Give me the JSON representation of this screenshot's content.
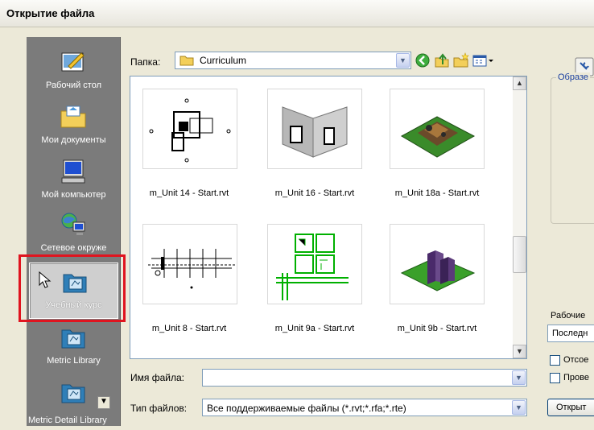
{
  "window": {
    "title": "Открытие файла"
  },
  "places": [
    {
      "label": "Рабочий стол",
      "icon": "desktop-icon"
    },
    {
      "label": "Мои документы",
      "icon": "my-documents-icon"
    },
    {
      "label": "Мой компьютер",
      "icon": "my-computer-icon"
    },
    {
      "label": "Сетевое окруже",
      "icon": "network-icon"
    },
    {
      "label": "Учебный курс",
      "icon": "training-folder-icon",
      "selected": true
    },
    {
      "label": "Metric Library",
      "icon": "library-folder-icon"
    },
    {
      "label": "Metric Detail Library",
      "icon": "library-folder-icon"
    }
  ],
  "toolbar": {
    "folder_label": "Папка:",
    "folder_value": "Curriculum"
  },
  "files": [
    {
      "name": "m_Unit 14 - Start.rvt"
    },
    {
      "name": "m_Unit 16 - Start.rvt"
    },
    {
      "name": "m_Unit 18a - Start.rvt"
    },
    {
      "name": "m_Unit 8 - Start.rvt"
    },
    {
      "name": "m_Unit 9a - Start.rvt"
    },
    {
      "name": "m_Unit 9b - Start.rvt"
    }
  ],
  "filename": {
    "label": "Имя файла:",
    "value": ""
  },
  "filetype": {
    "label": "Тип файлов:",
    "value": "Все поддерживаемые файлы (*.rvt;*.rfa;*.rte)"
  },
  "right_panel": {
    "preview_label": "Образе",
    "worksets_label": "Рабочие",
    "worksets_value": "Последн",
    "check1": "Отсое",
    "check2": "Прове",
    "open_button": "Открыт"
  },
  "colors": {
    "places_bg": "#7b7b7b",
    "highlight_frame": "#e0141f",
    "field_border": "#7f9db9"
  }
}
